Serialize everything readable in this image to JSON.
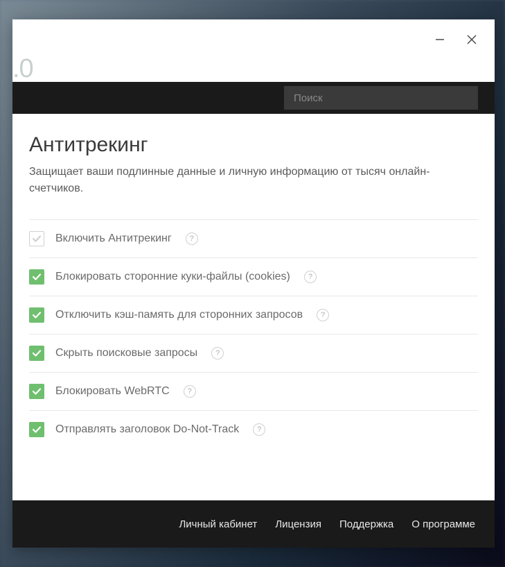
{
  "window": {
    "version_fragment": ".0"
  },
  "search": {
    "placeholder": "Поиск"
  },
  "page": {
    "title": "Антитрекинг",
    "subtitle": "Защищает ваши подлинные данные и личную информацию от тысяч онлайн-счетчиков."
  },
  "options": [
    {
      "label": "Включить Антитрекинг",
      "checked": false
    },
    {
      "label": "Блокировать сторонние куки-файлы (cookies)",
      "checked": true
    },
    {
      "label": "Отключить кэш-память для сторонних запросов",
      "checked": true
    },
    {
      "label": "Скрыть поисковые запросы",
      "checked": true
    },
    {
      "label": "Блокировать WebRTC",
      "checked": true
    },
    {
      "label": "Отправлять заголовок Do-Not-Track",
      "checked": true
    }
  ],
  "footer": {
    "links": [
      "Личный кабинет",
      "Лицензия",
      "Поддержка",
      "О программе"
    ]
  },
  "help_symbol": "?"
}
